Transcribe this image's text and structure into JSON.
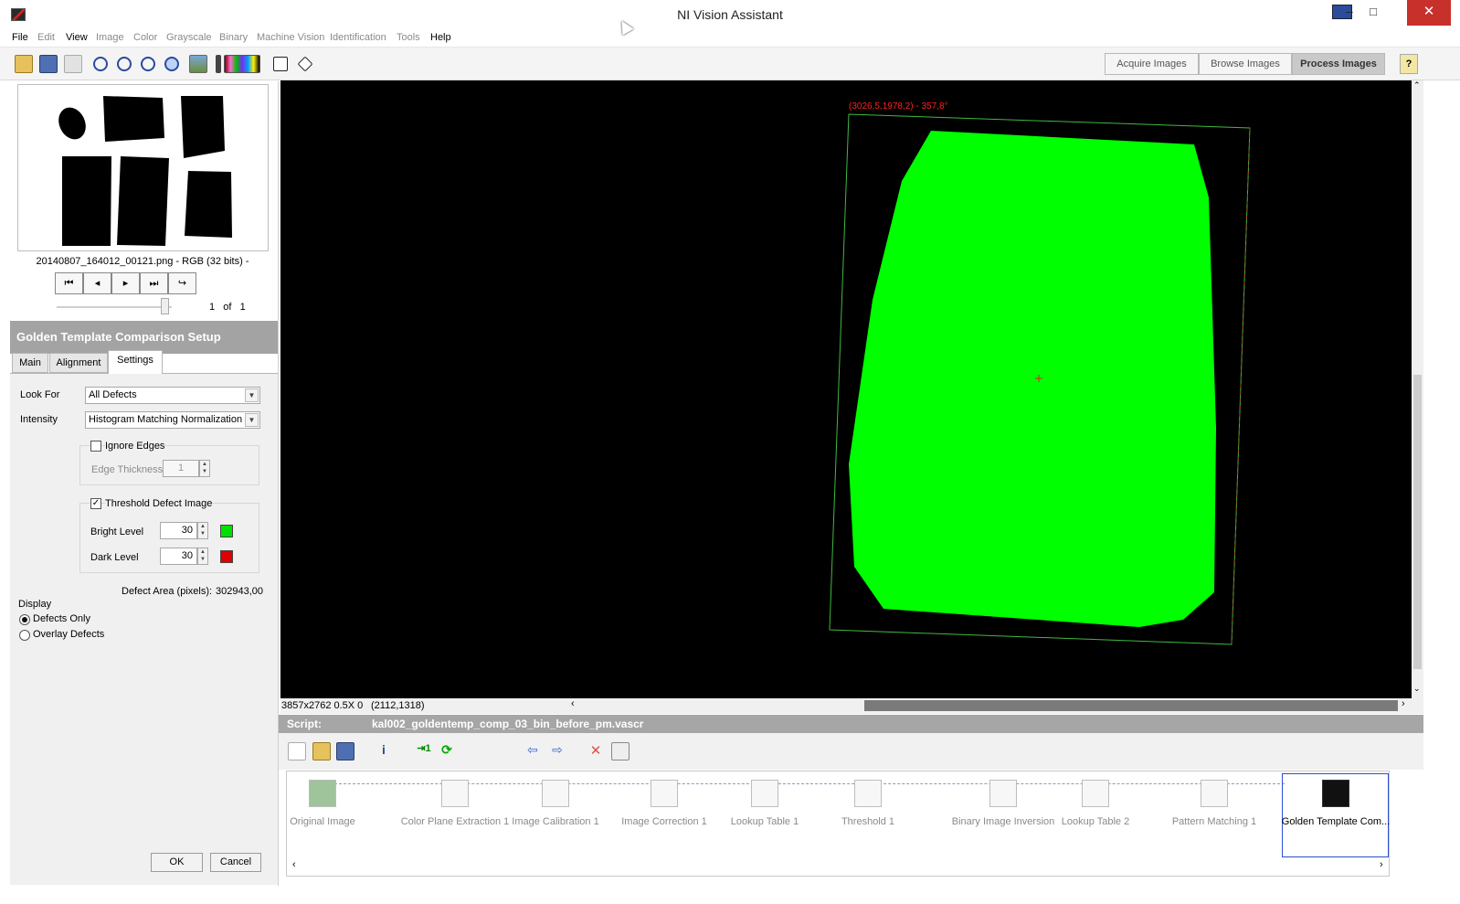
{
  "window": {
    "title": "NI Vision Assistant",
    "minimize": "–",
    "maximize": "□",
    "close": "✕"
  },
  "menu": [
    {
      "label": "File",
      "enabled": true
    },
    {
      "label": "Edit",
      "enabled": false
    },
    {
      "label": "View",
      "enabled": true
    },
    {
      "label": "Image",
      "enabled": false
    },
    {
      "label": "Color",
      "enabled": false
    },
    {
      "label": "Grayscale",
      "enabled": false
    },
    {
      "label": "Binary",
      "enabled": false
    },
    {
      "label": "Machine Vision",
      "enabled": false
    },
    {
      "label": "Identification",
      "enabled": false
    },
    {
      "label": "Tools",
      "enabled": false
    },
    {
      "label": "Help",
      "enabled": true
    }
  ],
  "modes": {
    "acquire": "Acquire Images",
    "browse": "Browse Images",
    "process": "Process Images",
    "help": "?"
  },
  "browser": {
    "caption": "20140807_164012_00121.png - RGB (32 bits) -",
    "nav": [
      "⏮",
      "◂",
      "▸",
      "⏭",
      "↪"
    ],
    "page_current": "1",
    "page_of": "of",
    "page_total": "1"
  },
  "setup": {
    "title": "Golden Template Comparison Setup",
    "tabs": [
      "Main",
      "Alignment",
      "Settings"
    ],
    "look_for_label": "Look For",
    "look_for_value": "All Defects",
    "intensity_label": "Intensity",
    "intensity_value": "Histogram Matching Normalization",
    "ignore_edges_label": "Ignore Edges",
    "edge_thickness_label": "Edge Thickness",
    "edge_thickness_value": "1",
    "threshold_label": "Threshold Defect Image",
    "bright_level_label": "Bright Level",
    "bright_level_value": "30",
    "dark_level_label": "Dark Level",
    "dark_level_value": "30",
    "bright_color": "#00e000",
    "dark_color": "#e00000",
    "defect_area_label": "Defect Area (pixels):",
    "defect_area_value": "302943,00",
    "display_label": "Display",
    "defects_only_label": "Defects Only",
    "overlay_defects_label": "Overlay Defects",
    "ok_label": "OK",
    "cancel_label": "Cancel"
  },
  "image": {
    "roi_label": "(3026,5,1978,2) - 357,8°",
    "blob_color": "#00ff00"
  },
  "status": {
    "image_info": "3857x2762 0.5X 0",
    "cursor": "(2112,1318)"
  },
  "script": {
    "label": "Script:",
    "name": "kal002_goldentemp_comp_03_bin_before_pm.vascr",
    "steps": [
      {
        "label": "Original Image"
      },
      {
        "label": "Color Plane Extraction 1"
      },
      {
        "label": "Image Calibration 1"
      },
      {
        "label": "Image Correction 1"
      },
      {
        "label": "Lookup Table 1"
      },
      {
        "label": "Threshold 1"
      },
      {
        "label": "Binary Image Inversion"
      },
      {
        "label": "Lookup Table 2"
      },
      {
        "label": "Pattern Matching 1"
      },
      {
        "label": "Golden Template Com..."
      }
    ]
  }
}
